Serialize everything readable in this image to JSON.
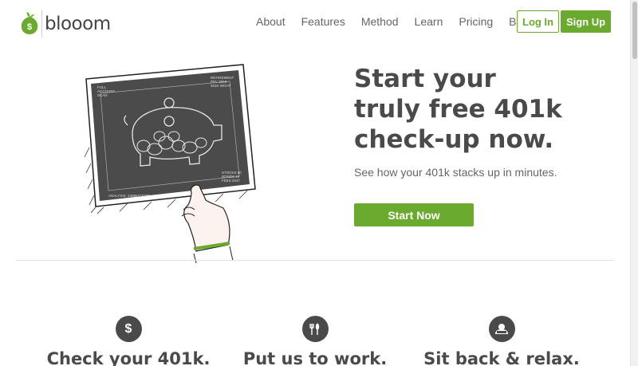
{
  "brand": {
    "name": "blooom",
    "color": "#6aaa2e"
  },
  "nav": {
    "items": [
      {
        "label": "About",
        "name": "nav-about"
      },
      {
        "label": "Features",
        "name": "nav-features"
      },
      {
        "label": "Method",
        "name": "nav-method"
      },
      {
        "label": "Learn",
        "name": "nav-learn"
      },
      {
        "label": "Pricing",
        "name": "nav-pricing"
      },
      {
        "label": "Blog",
        "name": "nav-blog"
      }
    ],
    "login_label": "Log In",
    "signup_label": "Sign Up"
  },
  "hero": {
    "title_lines": [
      "Start your",
      "truly free 401k",
      "check-up now."
    ],
    "subtitle": "See how your 401k stacks up in minutes.",
    "cta_label": "Start Now",
    "scan_card": {
      "top_left": [
        "FULL",
        "ACCOUNT",
        "SCAN"
      ],
      "top_right": [
        "RETIREMENT",
        "PIG: 2018",
        "401K WGHT"
      ],
      "bottom_right": [
        "STOCKS 90",
        "BONDS 10",
        "FEES 2047"
      ],
      "bottom_left": "ANALYSIS: 23986710230"
    }
  },
  "features": [
    {
      "title": "Check your 401k.",
      "icon": "dollar-icon",
      "glyph": "$"
    },
    {
      "title": "Put us to work.",
      "icon": "utensils-icon",
      "glyph": ""
    },
    {
      "title": "Sit back & relax.",
      "icon": "relax-icon",
      "glyph": ""
    }
  ]
}
